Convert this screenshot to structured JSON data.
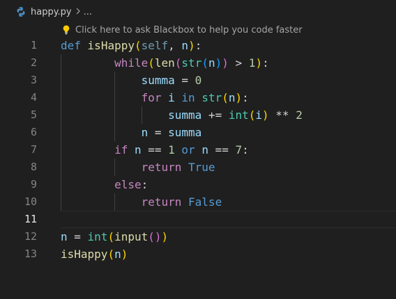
{
  "breadcrumb": {
    "filename": "happy.py",
    "separator": ">",
    "symbol": "..."
  },
  "codelens": {
    "text": "Click here to ask Blackbox to help you code faster"
  },
  "editor": {
    "current_line": 11,
    "lines": [
      {
        "number": "1",
        "tokens": [
          [
            "kw",
            "def"
          ],
          [
            "op",
            " "
          ],
          [
            "fn",
            "isHappy"
          ],
          [
            "b1",
            "("
          ],
          [
            "self-param",
            "self"
          ],
          [
            "op",
            ", "
          ],
          [
            "var",
            "n"
          ],
          [
            "b1",
            ")"
          ],
          [
            "op",
            ":"
          ]
        ]
      },
      {
        "number": "2",
        "tokens": [
          [
            "op",
            "        "
          ],
          [
            "ctl",
            "while"
          ],
          [
            "b1",
            "("
          ],
          [
            "fn",
            "len"
          ],
          [
            "b2",
            "("
          ],
          [
            "bi",
            "str"
          ],
          [
            "b3",
            "("
          ],
          [
            "var",
            "n"
          ],
          [
            "b3",
            ")"
          ],
          [
            "b2",
            ")"
          ],
          [
            "op",
            " > "
          ],
          [
            "num",
            "1"
          ],
          [
            "b1",
            ")"
          ],
          [
            "op",
            ":"
          ]
        ]
      },
      {
        "number": "3",
        "tokens": [
          [
            "op",
            "            "
          ],
          [
            "var",
            "summa"
          ],
          [
            "op",
            " = "
          ],
          [
            "num",
            "0"
          ]
        ]
      },
      {
        "number": "4",
        "tokens": [
          [
            "op",
            "            "
          ],
          [
            "ctl",
            "for"
          ],
          [
            "op",
            " "
          ],
          [
            "var",
            "i"
          ],
          [
            "op",
            " "
          ],
          [
            "kw",
            "in"
          ],
          [
            "op",
            " "
          ],
          [
            "bi",
            "str"
          ],
          [
            "b1",
            "("
          ],
          [
            "var",
            "n"
          ],
          [
            "b1",
            ")"
          ],
          [
            "op",
            ":"
          ]
        ]
      },
      {
        "number": "5",
        "tokens": [
          [
            "op",
            "                "
          ],
          [
            "var",
            "summa"
          ],
          [
            "op",
            " += "
          ],
          [
            "bi",
            "int"
          ],
          [
            "b1",
            "("
          ],
          [
            "var",
            "i"
          ],
          [
            "b1",
            ")"
          ],
          [
            "op",
            " ** "
          ],
          [
            "num",
            "2"
          ]
        ]
      },
      {
        "number": "6",
        "tokens": [
          [
            "op",
            "            "
          ],
          [
            "var",
            "n"
          ],
          [
            "op",
            " = "
          ],
          [
            "var",
            "summa"
          ]
        ]
      },
      {
        "number": "7",
        "tokens": [
          [
            "op",
            "        "
          ],
          [
            "ctl",
            "if"
          ],
          [
            "op",
            " "
          ],
          [
            "var",
            "n"
          ],
          [
            "op",
            " == "
          ],
          [
            "num",
            "1"
          ],
          [
            "op",
            " "
          ],
          [
            "kw",
            "or"
          ],
          [
            "op",
            " "
          ],
          [
            "var",
            "n"
          ],
          [
            "op",
            " == "
          ],
          [
            "num",
            "7"
          ],
          [
            "op",
            ":"
          ]
        ]
      },
      {
        "number": "8",
        "tokens": [
          [
            "op",
            "            "
          ],
          [
            "ctl",
            "return"
          ],
          [
            "op",
            " "
          ],
          [
            "kw",
            "True"
          ]
        ]
      },
      {
        "number": "9",
        "tokens": [
          [
            "op",
            "        "
          ],
          [
            "ctl",
            "else"
          ],
          [
            "op",
            ":"
          ]
        ]
      },
      {
        "number": "10",
        "tokens": [
          [
            "op",
            "            "
          ],
          [
            "ctl",
            "return"
          ],
          [
            "op",
            " "
          ],
          [
            "kw",
            "False"
          ]
        ]
      },
      {
        "number": "11",
        "tokens": []
      },
      {
        "number": "12",
        "tokens": [
          [
            "var",
            "n"
          ],
          [
            "op",
            " = "
          ],
          [
            "bi",
            "int"
          ],
          [
            "b1",
            "("
          ],
          [
            "fn",
            "input"
          ],
          [
            "b2",
            "()"
          ],
          [
            "b1",
            ")"
          ]
        ]
      },
      {
        "number": "13",
        "tokens": [
          [
            "fn",
            "isHappy"
          ],
          [
            "b1",
            "("
          ],
          [
            "var",
            "n"
          ],
          [
            "b1",
            ")"
          ]
        ]
      }
    ]
  },
  "colors": {
    "background": "#1f1f1f",
    "keyword": "#569cd6",
    "control": "#c586c0",
    "function": "#dcdcaa",
    "builtin": "#4ec9b0",
    "variable": "#9cdcfe",
    "number": "#b5cea8",
    "bracket_1": "#ffd700",
    "bracket_2": "#da70d6",
    "bracket_3": "#179fff"
  },
  "icons": {
    "file_icon": "python-icon",
    "codelens_icon": "lightbulb-icon",
    "breadcrumb_separator": "chevron-right-icon"
  }
}
